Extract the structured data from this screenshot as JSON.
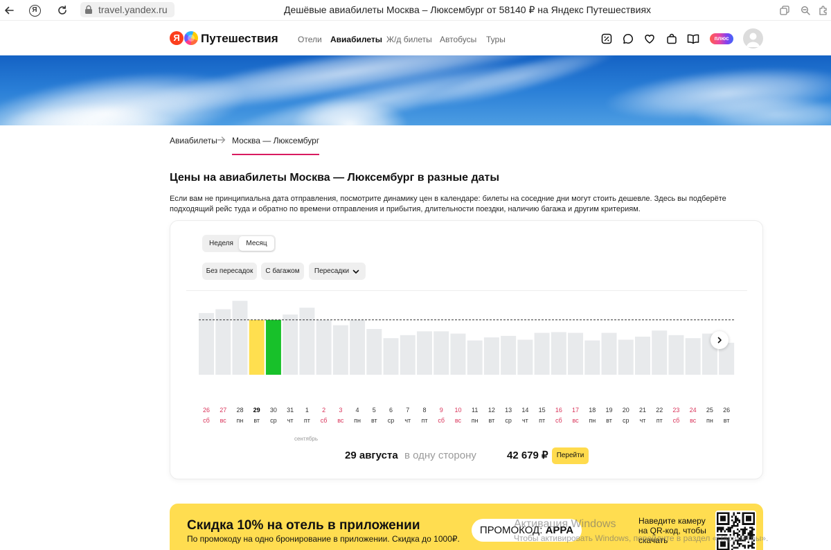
{
  "browser": {
    "yandex_button_label": "Я",
    "url": "travel.yandex.ru",
    "title": "Дешёвые авиабилеты Москва – Люксембург от 58140 ₽ на Яндекс Путешествиях"
  },
  "header": {
    "logo_letter": "Я",
    "brand": "Путешествия",
    "nav": [
      {
        "label": "Отели"
      },
      {
        "label": "Авиабилеты",
        "active": true
      },
      {
        "label": "Ж/д билеты"
      },
      {
        "label": "Автобусы"
      },
      {
        "label": "Туры"
      }
    ],
    "plus_label": "плюс",
    "icons": [
      "discount-icon",
      "chat-icon",
      "heart-icon",
      "bag-icon",
      "book-icon",
      "avatar"
    ]
  },
  "breadcrumb": {
    "items": [
      {
        "label": "Авиабилеты"
      },
      {
        "label": "Москва — Люксембург",
        "active": true
      }
    ]
  },
  "page": {
    "heading": "Цены на авиабилеты Москва — Люксембург в разные даты",
    "intro": "Если вам не принципиальна дата отправления, посмотрите динамику цен в календаре: билеты на соседние дни могут стоить дешевле. Здесь вы подберёте подходящий рейс туда и обратно по времени отправления и прибытия, длительности поездки, наличию багажа и другим критериям."
  },
  "calendar": {
    "period_tabs": [
      {
        "label": "Неделя"
      },
      {
        "label": "Месяц",
        "active": true
      }
    ],
    "filters": [
      {
        "label": "Без пересадок"
      },
      {
        "label": "С багажом"
      },
      {
        "label": "Пересадки",
        "dropdown": true
      }
    ],
    "month_label": "сентябрь",
    "summary": {
      "date": "29 августа",
      "direction": "в одну сторону",
      "price": "42 679 ₽",
      "button_label": "Перейти"
    }
  },
  "chart_data": {
    "type": "bar",
    "categories": [
      "26",
      "27",
      "28",
      "29",
      "30",
      "31",
      "1",
      "2",
      "3",
      "4",
      "5",
      "6",
      "7",
      "8",
      "9",
      "10",
      "11",
      "12",
      "13",
      "14",
      "15",
      "16",
      "17",
      "18",
      "19",
      "20",
      "21",
      "22",
      "23",
      "24",
      "25",
      "26"
    ],
    "weekdays": [
      "сб",
      "вс",
      "пн",
      "вт",
      "ср",
      "чт",
      "пт",
      "сб",
      "вс",
      "пн",
      "вт",
      "ср",
      "чт",
      "пт",
      "сб",
      "вс",
      "пн",
      "вт",
      "ср",
      "чт",
      "пт",
      "сб",
      "вс",
      "пн",
      "вт",
      "ср",
      "чт",
      "пт",
      "сб",
      "вс",
      "пн",
      "вт"
    ],
    "relative_values": [
      0.81,
      0.86,
      0.97,
      0.72,
      0.72,
      0.79,
      0.88,
      0.72,
      0.65,
      0.72,
      0.6,
      0.48,
      0.52,
      0.57,
      0.57,
      0.54,
      0.45,
      0.49,
      0.51,
      0.46,
      0.55,
      0.56,
      0.55,
      0.45,
      0.55,
      0.46,
      0.5,
      0.58,
      0.52,
      0.48,
      0.54,
      0.42
    ],
    "selected_index": 3,
    "highlight_index": 4,
    "reference_level": 0.72,
    "colors": {
      "bar": "#e8eaec",
      "selected": "#ffdf4f",
      "highlight": "#18c12a",
      "weekend": "#d9345a",
      "label": "#333333",
      "reference_line": "#333333"
    }
  },
  "promo": {
    "title": "Скидка 10% на отель в приложении",
    "subtitle": "По промокоду на одно бронирование в приложении. Скидка до 1000₽.",
    "code_label": "ПРОМОКОД:",
    "code": "APPA",
    "qr_hint": "Наведите камеру на QR-код, чтобы скачать"
  },
  "watermark": {
    "title": "Активация Windows",
    "text": "Чтобы активировать Windows, перейдите в раздел «Параметры»."
  },
  "colors": {
    "accent": "#d81b60",
    "weekend": "#d9345a",
    "button": "#ffdb4d",
    "promo": "#ffdd50"
  }
}
